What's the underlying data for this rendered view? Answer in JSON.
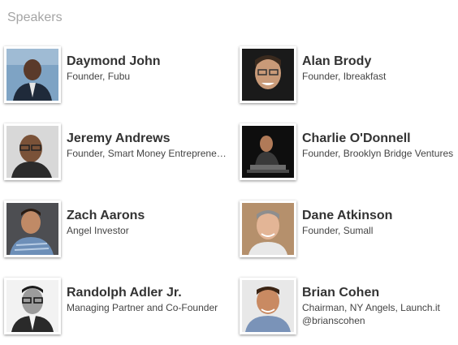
{
  "section": {
    "title": "Speakers"
  },
  "speakers": [
    {
      "name": "Daymond John",
      "title": "Founder, Fubu",
      "handle": ""
    },
    {
      "name": "Alan Brody",
      "title": "Founder, Ibreakfast",
      "handle": ""
    },
    {
      "name": "Jeremy Andrews",
      "title": "Founder, Smart Money Entrepreneurs",
      "handle": ""
    },
    {
      "name": "Charlie O'Donnell",
      "title": "Founder, Brooklyn Bridge Ventures",
      "handle": ""
    },
    {
      "name": "Zach Aarons",
      "title": "Angel Investor",
      "handle": ""
    },
    {
      "name": "Dane Atkinson",
      "title": "Founder, Sumall",
      "handle": ""
    },
    {
      "name": "Randolph Adler Jr.",
      "title": "Managing Partner and Co-Founder",
      "handle": ""
    },
    {
      "name": "Brian Cohen",
      "title": "Chairman, NY Angels, Launch.it",
      "handle": "@brianscohen"
    }
  ]
}
